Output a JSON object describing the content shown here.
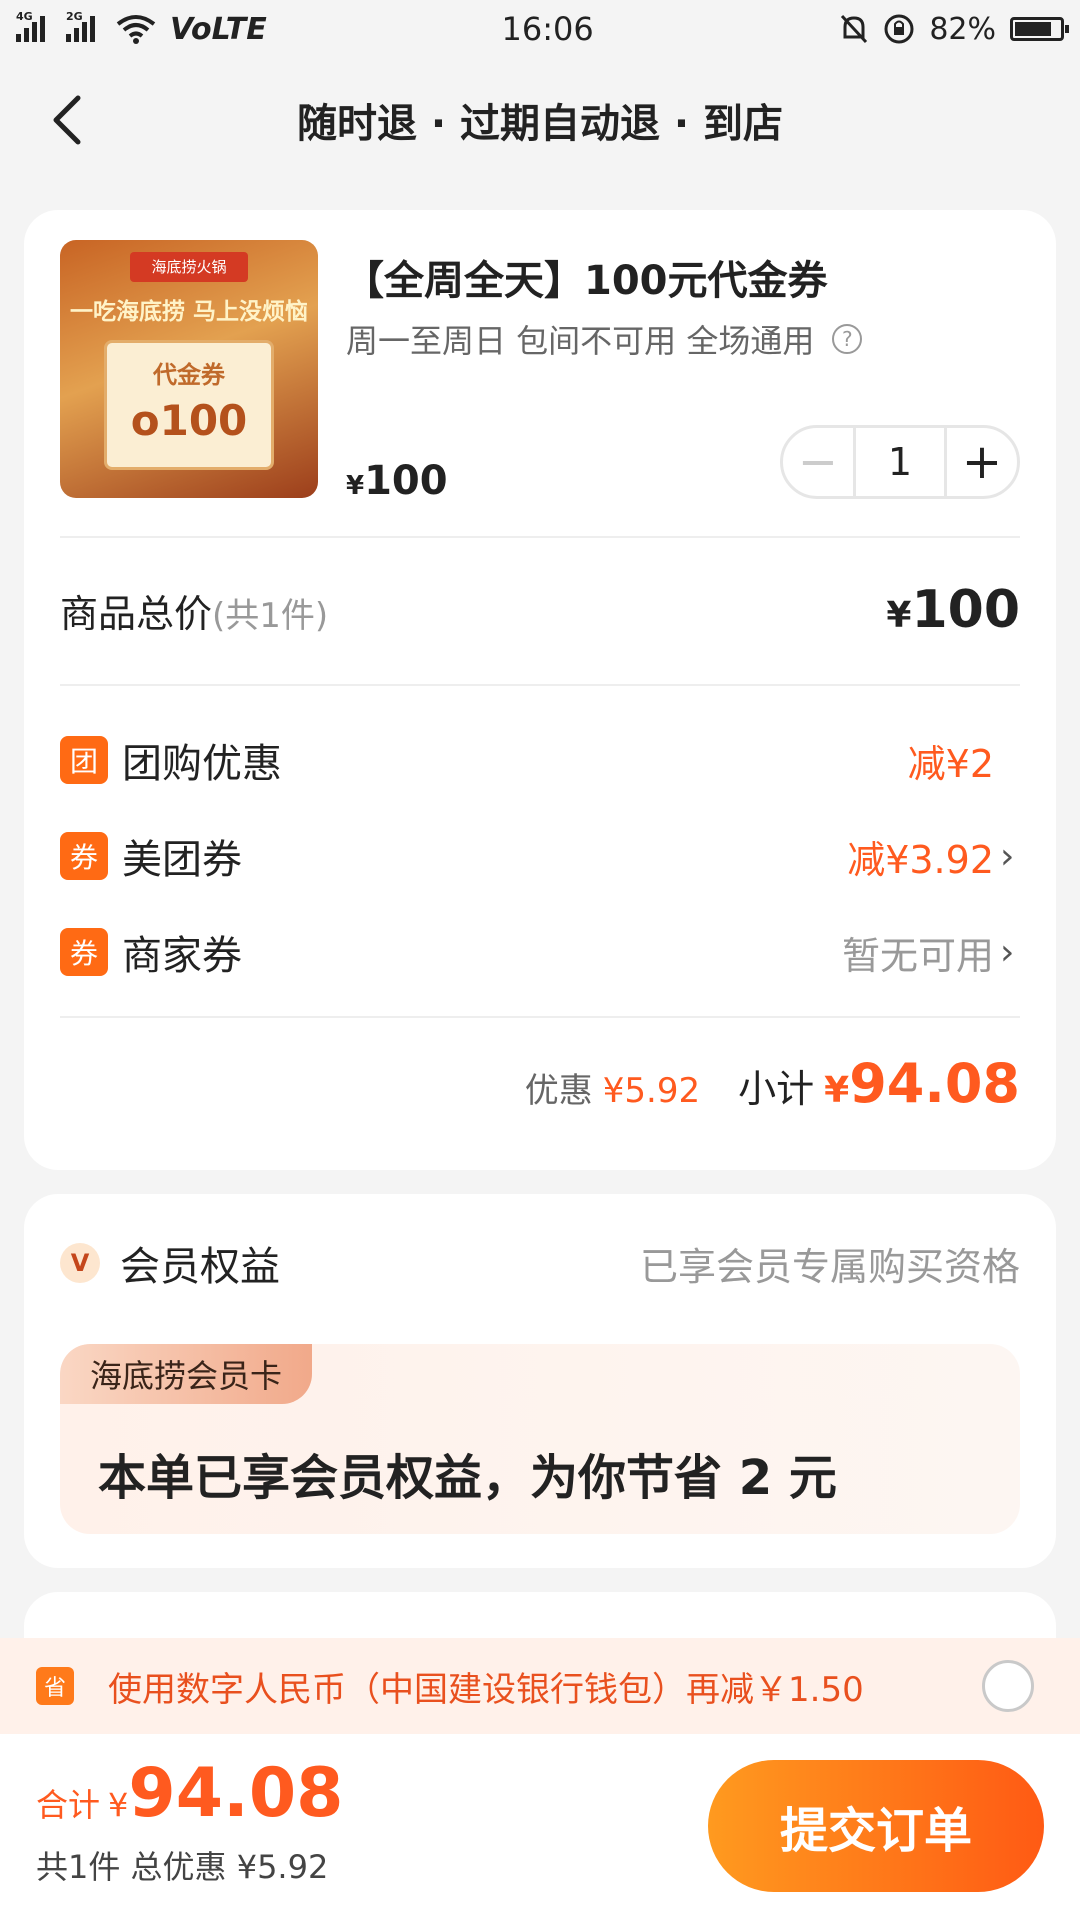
{
  "status_bar": {
    "network_1": "4G",
    "network_2": "2G",
    "volte": "VoLTE",
    "time": "16:06",
    "battery": "82%",
    "battery_level": 0.82
  },
  "header": {
    "title": "随时退 · 过期自动退 · 到店"
  },
  "product": {
    "thumb_badge": "海底捞火锅",
    "thumb_slogan": "一吃海底捞 马上没烦恼",
    "thumb_ticket_label": "代金券",
    "thumb_ticket_value": "o100",
    "title": "【全周全天】100元代金券",
    "subtitle": "周一至周日 包间不可用 全场通用",
    "help_icon": "?",
    "price_symbol": "¥",
    "price": "100",
    "quantity": "1",
    "minus": "−",
    "plus": "+"
  },
  "total": {
    "label": "商品总价",
    "count": "(共1件)",
    "symbol": "¥",
    "value": "100"
  },
  "discounts": [
    {
      "icon": "团",
      "label": "团购优惠",
      "value": "减¥2",
      "muted": false
    },
    {
      "icon": "券",
      "label": "美团券",
      "value": "减¥3.92",
      "muted": false
    },
    {
      "icon": "券",
      "label": "商家券",
      "value": "暂无可用",
      "muted": true
    }
  ],
  "summary": {
    "discount_label": "优惠",
    "discount_value": "¥5.92",
    "subtotal_label": "小计",
    "subtotal_symbol": "¥",
    "subtotal_value": "94.08"
  },
  "member": {
    "icon": "V",
    "title": "会员权益",
    "note": "已享会员专属购买资格",
    "card_tag": "海底捞会员卡",
    "card_text": "本单已享会员权益，为你节省 2 元"
  },
  "promo": {
    "icon": "省",
    "text": "使用数字人民币（中国建设银行钱包）再减￥1.50"
  },
  "bottom": {
    "total_label": "合计",
    "symbol": "¥",
    "amount": "94.08",
    "sub": "共1件  总优惠 ¥5.92",
    "submit": "提交订单"
  },
  "colors": {
    "accent": "#ff5a1f",
    "button_start": "#ff9a1f",
    "button_end": "#ff5a14",
    "background": "#f4f4f4"
  }
}
